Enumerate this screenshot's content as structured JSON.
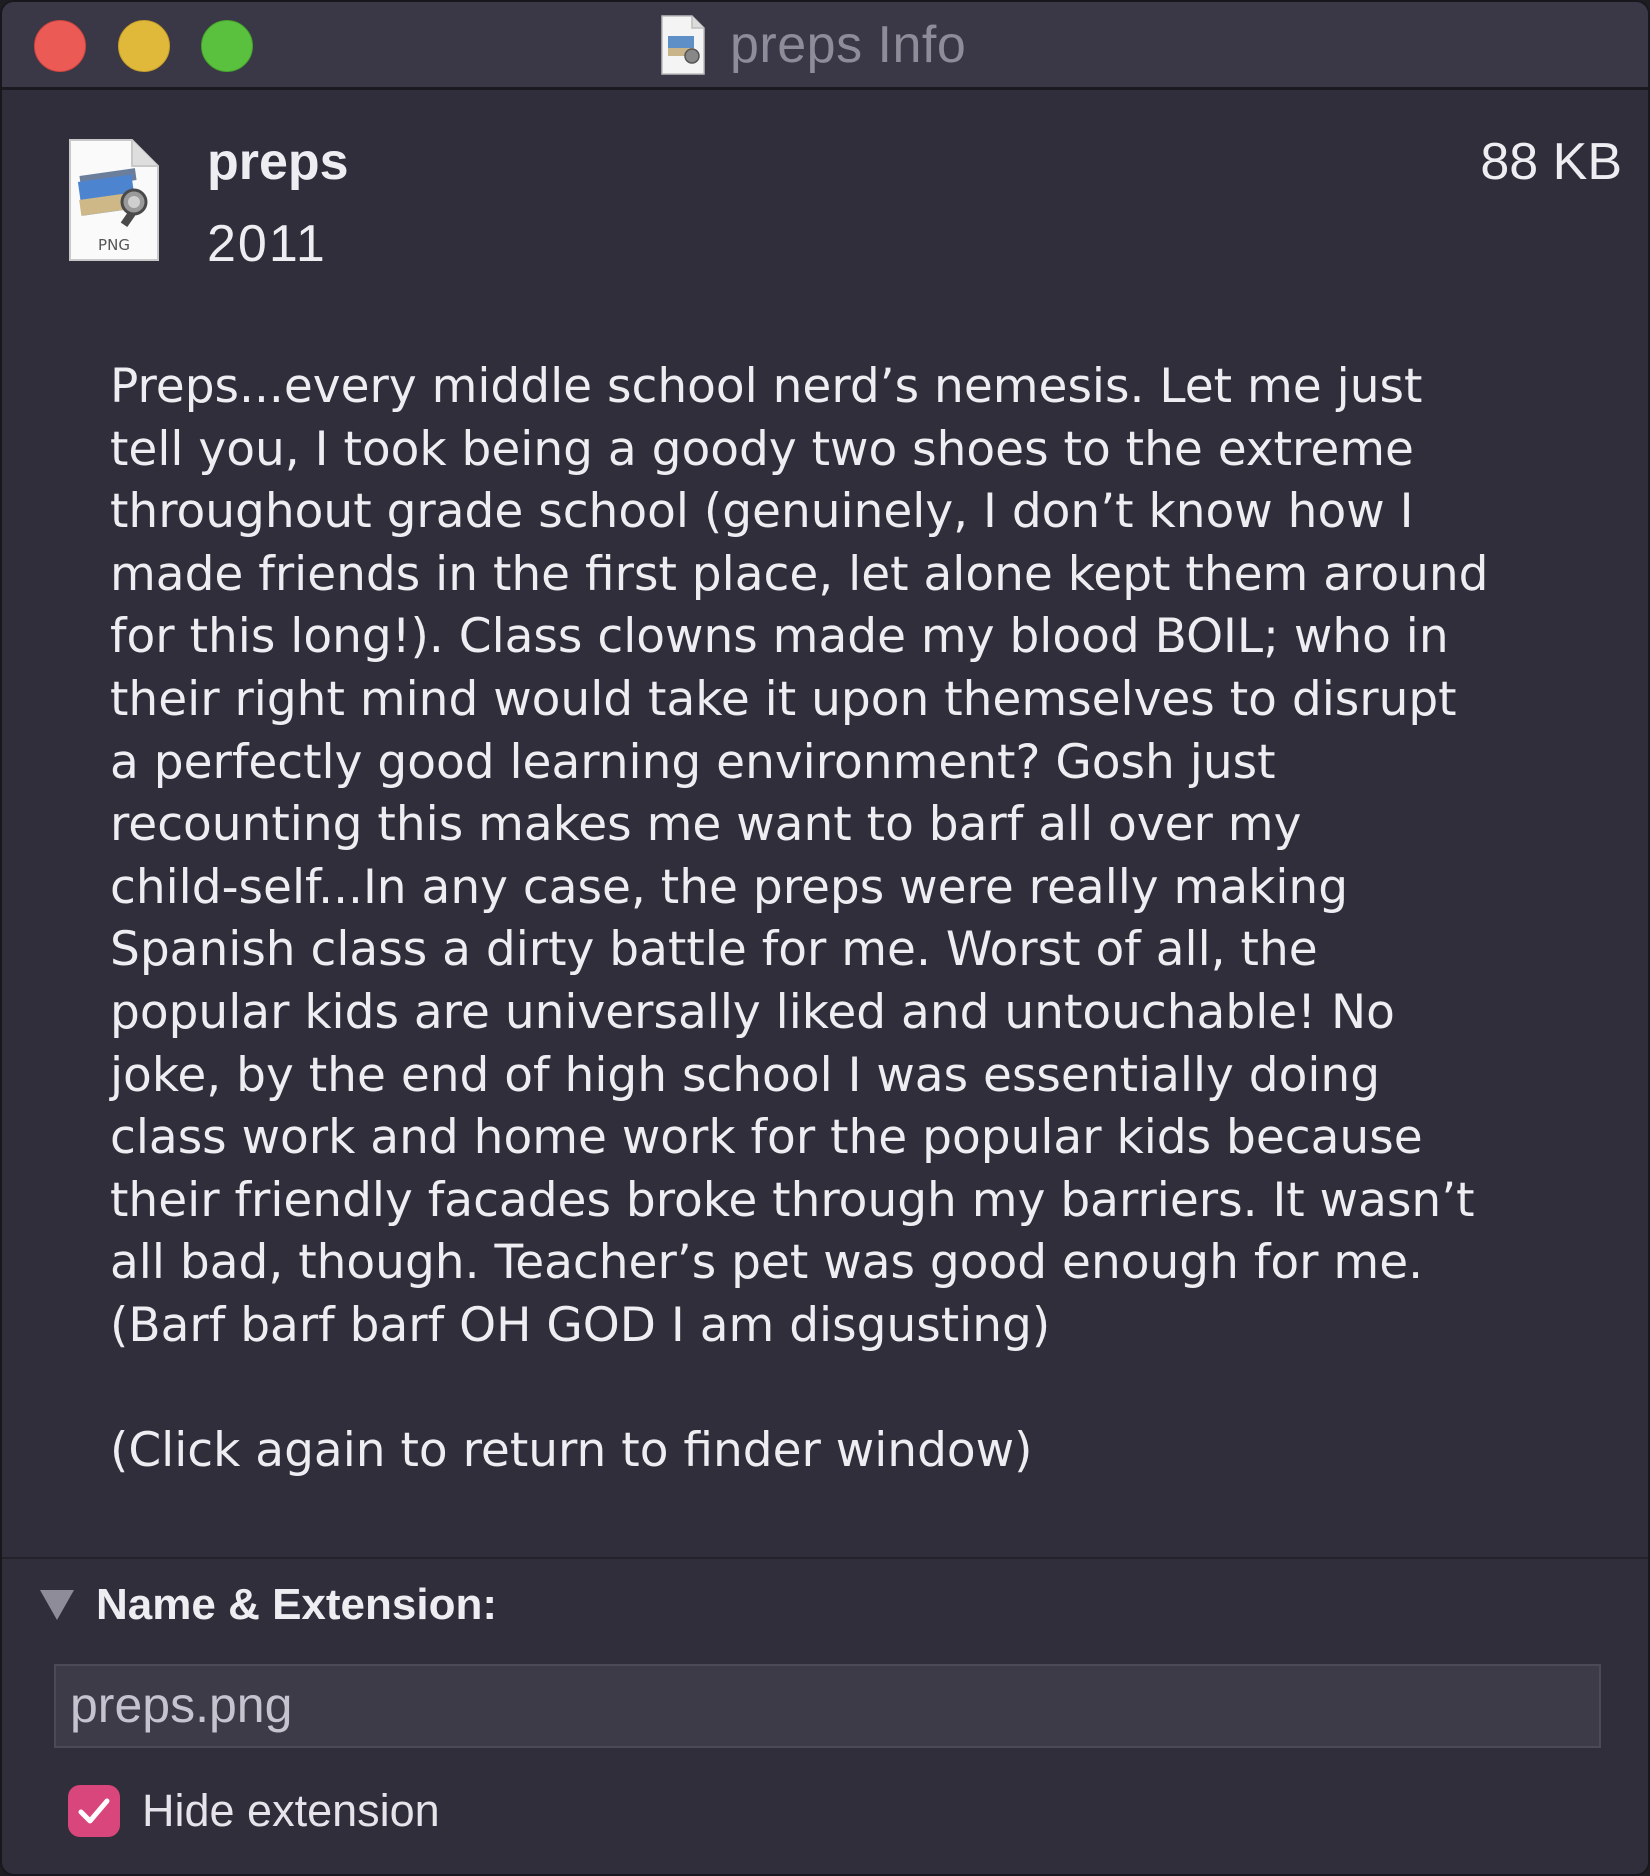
{
  "window": {
    "title": "preps Info"
  },
  "file": {
    "name": "preps",
    "year": "2011",
    "size": "88 KB",
    "icon": "png-image-file-icon",
    "type_badge": "PNG"
  },
  "comment": {
    "lines": [
      "Preps...every middle school nerd’s nemesis. Let me just",
      "tell you, I took being a goody two shoes to the extreme",
      "throughout grade school (genuinely, I don’t know how I",
      "made friends in the first place, let alone kept them around",
      "for this long!). Class clowns made my blood BOIL; who in",
      "their right mind would take it upon themselves to disrupt",
      "a perfectly good learning environment? Gosh just",
      "recounting this makes me want to barf all over my",
      "child-self...In any case, the preps were really making",
      "Spanish class a dirty battle for me. Worst of all, the",
      "popular kids are universally liked and untouchable! No",
      "joke, by the end of high school I was essentially doing",
      "class work and home work for the popular kids because",
      "their friendly facades broke through my barriers. It wasn’t",
      "all bad, though. Teacher’s pet was good enough for me.",
      "(Barf barf barf OH GOD I am disgusting)"
    ],
    "footer": "(Click again to return to finder window)"
  },
  "name_extension": {
    "header": "Name & Extension:",
    "value": "preps.png",
    "hide_extension_label": "Hide extension",
    "hide_extension_checked": true
  },
  "colors": {
    "background": "#302e3a",
    "titlebar": "#3a3846",
    "close": "#ec5a55",
    "minimize": "#e0b93a",
    "zoom": "#5ac13e",
    "checkbox_accent": "#d9467b"
  }
}
